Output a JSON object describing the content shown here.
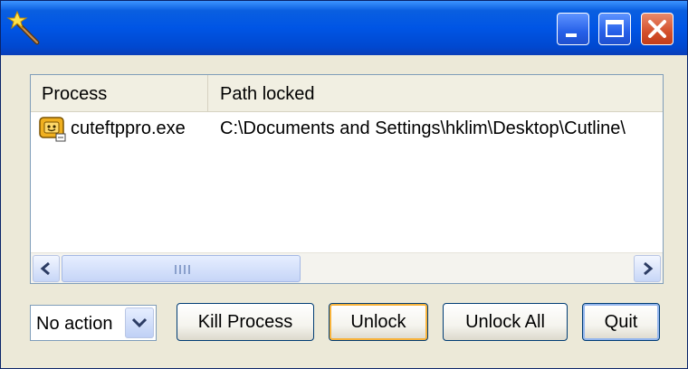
{
  "window": {
    "title": ""
  },
  "titlebar": {
    "icon": "magic-wand-icon",
    "buttons": [
      "minimize-icon",
      "maximize-icon",
      "close-icon"
    ]
  },
  "list": {
    "columns": [
      "Process",
      "Path locked"
    ],
    "rows": [
      {
        "icon": "cuteftp-app-icon",
        "process": "cuteftppro.exe",
        "path": "C:\\Documents and Settings\\hklim\\Desktop\\Cutline\\"
      }
    ]
  },
  "action_select": {
    "value": "No action"
  },
  "buttons": {
    "kill_process": "Kill Process",
    "unlock": "Unlock",
    "unlock_all": "Unlock All",
    "quit": "Quit"
  },
  "colors": {
    "titlebar": "#0055e5",
    "close_button": "#d4502c",
    "window_bg": "#ece9d8",
    "default_button_border": "#f8b33b"
  }
}
